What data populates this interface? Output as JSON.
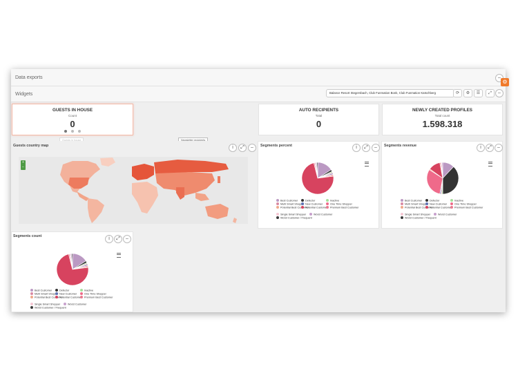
{
  "header": {
    "data_exports": "Data exports",
    "widgets": "Widgets",
    "filter_select": "Balance Resort Stegersbach, Club Funmation Bonk, Club Funmation Katschberg"
  },
  "kpis": [
    {
      "title": "GUESTS IN HOUSE",
      "subtitle": "Count",
      "value": "0"
    },
    {
      "title": "AUTO RECIPIENTS",
      "subtitle": "Total",
      "value": "0"
    },
    {
      "title": "NEWLY CREATED PROFILES",
      "subtitle": "Total count",
      "value": "1.598.318"
    }
  ],
  "tooltips": {
    "guests": "Guests in house",
    "newsletter": "Newsletter recipients"
  },
  "panels": {
    "map": {
      "title": "Guests country map"
    },
    "percent": {
      "title": "Segments percent"
    },
    "revenue": {
      "title": "Segments revenue"
    },
    "count": {
      "title": "Segments count"
    }
  },
  "colors": {
    "accent": "#f07a2b",
    "map_land": "#f2a488",
    "map_ocean": "#e8e8e8",
    "zoom": "#4f9b45"
  },
  "chart_data": [
    {
      "type": "pie",
      "title": "Segments percent",
      "categories": [
        "Best Customer",
        "Defector",
        "Inactive",
        "Multi Smart Shopper",
        "New Customer",
        "One Time Shopper",
        "Potential Best Customer",
        "Potential Customer",
        "Premium Best Customer",
        "Single Smart Shopper",
        "Worst Customer",
        "Worst Customer / Frequent"
      ],
      "values": [
        16,
        2,
        1,
        1,
        1,
        1,
        1,
        73,
        1,
        1,
        1,
        1
      ],
      "colors": [
        "#bb99c3",
        "#333333",
        "#a6e09b",
        "#d98aa3",
        "#5e73b5",
        "#ef6a8a",
        "#f0a88a",
        "#d7435f",
        "#e97a8e",
        "#f5c6d3",
        "#c7a0cc",
        "#3a3a3a"
      ],
      "legend": "bottom"
    },
    {
      "type": "pie",
      "title": "Segments revenue",
      "categories": [
        "Best Customer",
        "Defector",
        "Inactive",
        "Multi Smart Shopper",
        "New Customer",
        "One Time Shopper",
        "Potential Best Customer",
        "Potential Customer",
        "Premium Best Customer",
        "Single Smart Shopper",
        "Worst Customer",
        "Worst Customer / Frequent"
      ],
      "values": [
        12,
        38,
        1,
        1,
        1,
        31,
        1,
        12,
        1,
        1,
        1,
        0
      ],
      "colors": [
        "#bb99c3",
        "#333333",
        "#a6e09b",
        "#d98aa3",
        "#5e73b5",
        "#ef6a8a",
        "#f0a88a",
        "#d7435f",
        "#e97a8e",
        "#f5c6d3",
        "#c7a0cc",
        "#3a3a3a"
      ],
      "legend": "bottom"
    },
    {
      "type": "pie",
      "title": "Segments count",
      "categories": [
        "Best Customer",
        "Defector",
        "Inactive",
        "Multi Smart Shopper",
        "New Customer",
        "One Time Shopper",
        "Potential Best Customer",
        "Potential Customer",
        "Premium Best Customer",
        "Single Smart Shopper",
        "Worst Customer",
        "Worst Customer / Frequent"
      ],
      "values": [
        16,
        2,
        1,
        1,
        1,
        1,
        1,
        73,
        1,
        1,
        1,
        1
      ],
      "colors": [
        "#bb99c3",
        "#333333",
        "#a6e09b",
        "#d98aa3",
        "#5e73b5",
        "#ef6a8a",
        "#f0a88a",
        "#d7435f",
        "#e97a8e",
        "#f5c6d3",
        "#c7a0cc",
        "#3a3a3a"
      ],
      "legend": "bottom"
    }
  ]
}
